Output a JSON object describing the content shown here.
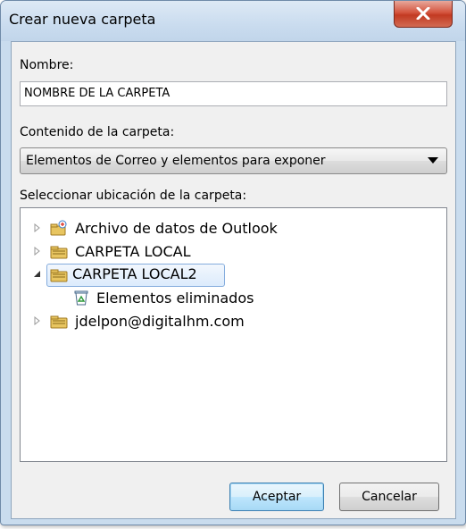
{
  "dialog": {
    "title": "Crear nueva carpeta"
  },
  "name_field": {
    "label": "Nombre:",
    "value": "NOMBRE DE LA CARPETA"
  },
  "contents": {
    "label": "Contenido de la carpeta:",
    "selected": "Elementos de Correo y elementos para exponer"
  },
  "location": {
    "label": "Seleccionar ubicación de la carpeta:",
    "nodes": [
      {
        "label": "Archivo de datos de Outlook",
        "icon": "outlook-data-file-icon",
        "expander": "collapsed",
        "level": 0
      },
      {
        "label": "CARPETA LOCAL",
        "icon": "pst-folder-icon",
        "expander": "collapsed",
        "level": 0
      },
      {
        "label": "CARPETA LOCAL2",
        "icon": "pst-folder-icon",
        "expander": "expanded",
        "level": 0,
        "selected": true
      },
      {
        "label": "Elementos eliminados",
        "icon": "deleted-items-icon",
        "expander": "none",
        "level": 1
      },
      {
        "label": "jdelpon@digitalhm.com",
        "icon": "pst-folder-icon",
        "expander": "collapsed",
        "level": 0
      }
    ]
  },
  "buttons": {
    "ok": "Aceptar",
    "cancel": "Cancelar"
  },
  "colors": {
    "frame": "#c9dcee",
    "close": "#c8432b",
    "selection_border": "#84acdd"
  }
}
